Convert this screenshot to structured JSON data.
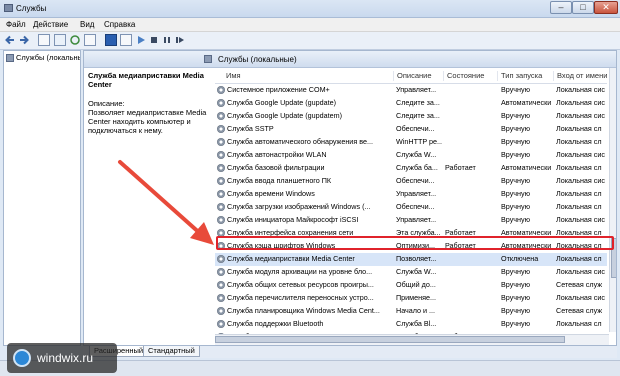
{
  "window": {
    "title": "Службы"
  },
  "menu": [
    "Файл",
    "Действие",
    "Вид",
    "Справка"
  ],
  "tree": {
    "root_label": "Службы (локальны"
  },
  "panel": {
    "header": "Службы (локальные)",
    "selected_service_name": "Служба медиаприставки Media Center",
    "description_label": "Описание:",
    "description_text": "Позволяет медиаприставке Media Center находить компьютер и подключаться к нему."
  },
  "columns": {
    "name": "Имя",
    "description": "Описание",
    "state": "Состояние",
    "startup": "Тип запуска",
    "logon": "Вход от имени"
  },
  "services": [
    {
      "name": "Системное приложение COM+",
      "description": "Управляет...",
      "state": "",
      "startup": "Вручную",
      "logon": "Локальная сис"
    },
    {
      "name": "Служба Google Update (gupdate)",
      "description": "Следите за...",
      "state": "",
      "startup": "Автоматически",
      "logon": "Локальная сис"
    },
    {
      "name": "Служба Google Update (gupdatem)",
      "description": "Следите за...",
      "state": "",
      "startup": "Вручную",
      "logon": "Локальная сис"
    },
    {
      "name": "Служба SSTP",
      "description": "Обеспечи...",
      "state": "",
      "startup": "Вручную",
      "logon": "Локальная сл"
    },
    {
      "name": "Служба автоматического обнаружения ве...",
      "description": "WinHTTP ре...",
      "state": "",
      "startup": "Вручную",
      "logon": "Локальная сл"
    },
    {
      "name": "Служба автонастройки WLAN",
      "description": "Служба W...",
      "state": "",
      "startup": "Вручную",
      "logon": "Локальная сис"
    },
    {
      "name": "Служба базовой фильтрации",
      "description": "Служба ба...",
      "state": "Работает",
      "startup": "Автоматически",
      "logon": "Локальная сл"
    },
    {
      "name": "Служба ввода планшетного ПК",
      "description": "Обеспечи...",
      "state": "",
      "startup": "Вручную",
      "logon": "Локальная сис"
    },
    {
      "name": "Служба времени Windows",
      "description": "Управляет...",
      "state": "",
      "startup": "Вручную",
      "logon": "Локальная сл"
    },
    {
      "name": "Служба загрузки изображений Windows (...",
      "description": "Обеспечи...",
      "state": "",
      "startup": "Вручную",
      "logon": "Локальная сл"
    },
    {
      "name": "Служба инициатора Майкрософт iSCSI",
      "description": "Управляет...",
      "state": "",
      "startup": "Вручную",
      "logon": "Локальная сис"
    },
    {
      "name": "Служба интерфейса сохранения сети",
      "description": "Эта служба...",
      "state": "Работает",
      "startup": "Автоматически",
      "logon": "Локальная сл"
    },
    {
      "name": "Служба кэша шрифтов Windows",
      "description": "Оптимизи...",
      "state": "Работает",
      "startup": "Автоматически",
      "logon": "Локальная сл"
    },
    {
      "name": "Служба медиаприставки Media Center",
      "description": "Позволяет...",
      "state": "",
      "startup": "Отключена",
      "logon": "Локальная сл"
    },
    {
      "name": "Служба модуля архивации на уровне бло...",
      "description": "Служба W...",
      "state": "",
      "startup": "Вручную",
      "logon": "Локальная сис"
    },
    {
      "name": "Служба общих сетевых ресурсов проигры...",
      "description": "Общий до...",
      "state": "",
      "startup": "Вручную",
      "logon": "Сетевая служ"
    },
    {
      "name": "Служба перечислителя переносных устро...",
      "description": "Применяе...",
      "state": "",
      "startup": "Вручную",
      "logon": "Локальная сис"
    },
    {
      "name": "Служба планировщика Windows Media Cent...",
      "description": "Начало и ...",
      "state": "",
      "startup": "Вручную",
      "logon": "Сетевая служ"
    },
    {
      "name": "Служба поддержки Bluetooth",
      "description": "Служба Bl...",
      "state": "",
      "startup": "Вручную",
      "logon": "Локальная сл"
    },
    {
      "name": "Служба политики диагностики",
      "description": "Служба п...",
      "state": "Работает",
      "startup": "Автоматически",
      "logon": "Локальная сл"
    },
    {
      "name": "Служба помощника по совместимости пр...",
      "description": "Обеспечи...",
      "state": "Работает",
      "startup": "Автоматически",
      "logon": "Локальная сис"
    }
  ],
  "tabs": [
    "Расширенный",
    "Стандартный"
  ],
  "watermark": "windwix.ru",
  "colors": {
    "highlight": "#e0232b",
    "arrow": "#e84a3a"
  }
}
